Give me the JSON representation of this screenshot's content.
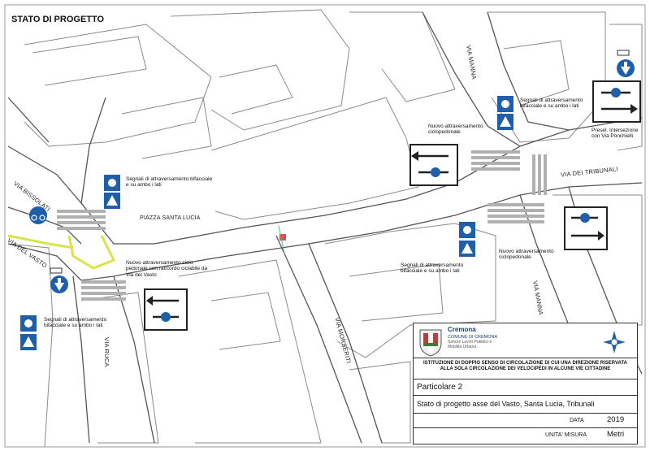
{
  "map": {
    "title": "STATO DI PROGETTO",
    "streets": {
      "via_bissolati": "VIA BISSOLATI",
      "via_del_vasto": "VIA DEL VASTO",
      "via_ruca": "VIA RUCA",
      "via_manna_top": "VIA MANNA",
      "via_manna_bottom": "VIA MANNA",
      "via_dei_tribunali": "VIA DEI TRIBUNALI",
      "via_morseriti": "VIA MORSERITI",
      "piazza_santa_lucia": "PIAZZA SANTA LUCIA"
    },
    "notes": {
      "segnali_top_left": "Segnali di attraversamento bifacciale e su ambo i lati",
      "segnali_bottom_left": "Segnali di attraversamento bifacciale e su ambo i lati",
      "segnali_top_right": "Segnali di attraversamento bifacciale e su ambo i lati",
      "segnali_center_right": "Segnali di attraversamento bifacciale e su ambo i lati",
      "nuovo_ciclopedonale_top": "Nuovo attraversamento ciclopedonale",
      "nuovo_ciclopedonale_right": "Nuovo attraversamento ciclopedonale",
      "nuovo_raccordo": "Nuovo attraversamento ciclo pedonale con raccordo ciclabile da Via del Vasto",
      "presel": "Presel. Intersezione con Via Ponchielli"
    },
    "colors": {
      "sign_blue": "#1f5ea8",
      "cycle_lane": "#d9e34a",
      "road_line": "#555555",
      "crossing_stripe": "#b0b0b0"
    }
  },
  "titleblock": {
    "city": "Cremona",
    "office_1": "COMUNE DI CREMONA",
    "office_2": "Settore Lavori Pubblici e",
    "office_3": "Mobilità Urbana",
    "description": "ISTITUZIONE DI DOPPIO SENSO DI CIRCOLAZIONE DI CUI UNA DIREZIONE RISERVATA ALLA SOLA CIRCOLAZIONE DEI VELOCIPEDI IN ALCUNE VIE CITTADINE",
    "sheet": "Particolare 2",
    "subject": "Stato di progetto asse del Vasto, Santa Lucia, Tribunali",
    "data_label": "DATA",
    "data_value": "2019",
    "unit_label": "UNITA' MISURA",
    "unit_value": "Metri",
    "compass_icon": "compass-rose-icon",
    "crest_icon": "cremona-crest-icon"
  }
}
